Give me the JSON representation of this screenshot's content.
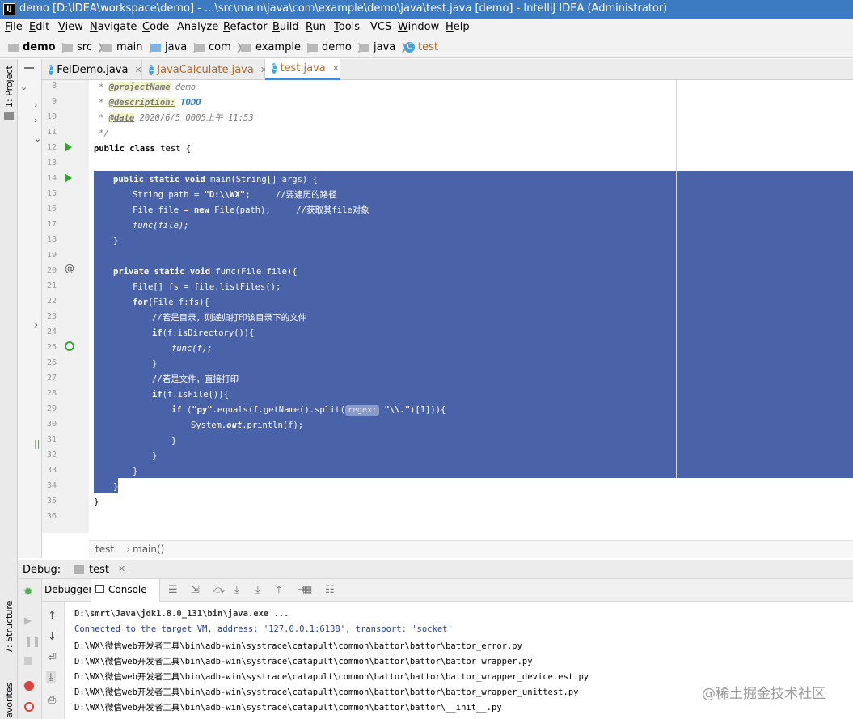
{
  "window": {
    "title": "demo [D:\\IDEA\\workspace\\demo] - ...\\src\\main\\java\\com\\example\\demo\\java\\test.java [demo] - IntelliJ IDEA (Administrator)",
    "app_icon": "IJ"
  },
  "menu": [
    {
      "label": "File",
      "u": "F",
      "rest": "ile"
    },
    {
      "label": "Edit",
      "u": "E",
      "rest": "dit"
    },
    {
      "label": "View",
      "u": "V",
      "rest": "iew"
    },
    {
      "label": "Navigate",
      "u": "N",
      "rest": "avigate"
    },
    {
      "label": "Code",
      "u": "C",
      "rest": "ode"
    },
    {
      "label": "Analyze",
      "u": "",
      "rest": "Analyze"
    },
    {
      "label": "Refactor",
      "u": "R",
      "rest": "efactor"
    },
    {
      "label": "Build",
      "u": "B",
      "rest": "uild"
    },
    {
      "label": "Run",
      "u": "R",
      "rest": "un"
    },
    {
      "label": "Tools",
      "u": "T",
      "rest": "ools"
    },
    {
      "label": "VCS",
      "u": "",
      "rest": "VCS"
    },
    {
      "label": "Window",
      "u": "W",
      "rest": "indow"
    },
    {
      "label": "Help",
      "u": "H",
      "rest": "elp"
    }
  ],
  "breadcrumb": [
    "demo",
    "src",
    "main",
    "java",
    "com",
    "example",
    "demo",
    "java",
    "test"
  ],
  "sidebar": {
    "project_label": "1: Project",
    "structure_label": "7: Structure",
    "favorites_label": "avorites"
  },
  "tabs": [
    {
      "label": "FelDemo.java",
      "active": false
    },
    {
      "label": "JavaCalculate.java",
      "active": false
    },
    {
      "label": "test.java",
      "active": true
    }
  ],
  "line_numbers": [
    "8",
    "9",
    "10",
    "11",
    "12",
    "13",
    "14",
    "15",
    "16",
    "17",
    "18",
    "19",
    "20",
    "21",
    "22",
    "23",
    "24",
    "25",
    "26",
    "27",
    "28",
    "29",
    "30",
    "31",
    "32",
    "33",
    "34",
    "35",
    "36"
  ],
  "code": {
    "l8_tag": "@projectName",
    "l8_val": " demo",
    "l9_tag": "@description:",
    "l9_val": "TODO",
    "l10_tag": "@date",
    "l10_val": " 2020/6/5 0005上午 11:53",
    "l11": " */",
    "l12_kw": "public class",
    "l12_rest": " test {",
    "l14_kw": "public static void",
    "l14_rest": " main(String[] args) {",
    "l15_a": "String path = ",
    "l15_str": "\"D:\\\\WX\";",
    "l15_c": "     //要遍历的路径",
    "l16_a": "File file = ",
    "l16_kw": "new",
    "l16_b": " File(path);",
    "l16_c": "     //获取其file对象",
    "l17": "func(file);",
    "l18": "}",
    "l20_kw": "private static void",
    "l20_rest": " func(File file){",
    "l21": "File[] fs = file.listFiles();",
    "l22_kw": "for",
    "l22_rest": "(File f:fs){",
    "l23": "//若是目录，则递归打印该目录下的文件",
    "l24_kw": "if",
    "l24_rest": "(f.isDirectory()){",
    "l25": "func(f);",
    "l26": "}",
    "l27": "//若是文件，直接打印",
    "l28_kw": "if",
    "l28_rest": "(f.isFile()){",
    "l29_kw": "if",
    "l29_a": " (",
    "l29_str": "\"py\"",
    "l29_b": ".equals(f.getName().split(",
    "l29_hint": "regex:",
    "l29_str2": " \"\\\\.\"",
    "l29_c": ")[1])){",
    "l30_a": "System.",
    "l30_out": "out",
    "l30_b": ".println(f);",
    "l31": "}",
    "l32": "}",
    "l33": "}",
    "l34": "}",
    "l35": "}"
  },
  "editor_crumb": [
    "test",
    "main()"
  ],
  "debug": {
    "title": "Debug:",
    "config": "test",
    "tab_debugger": "Debugger",
    "tab_console": "Console",
    "console_lines": [
      "D:\\smrt\\Java\\jdk1.8.0_131\\bin\\java.exe ...",
      "Connected to the target VM, address: '127.0.0.1:6138', transport: 'socket'",
      "D:\\WX\\微信web开发者工具\\bin\\adb-win\\systrace\\catapult\\common\\battor\\battor\\battor_error.py",
      "D:\\WX\\微信web开发者工具\\bin\\adb-win\\systrace\\catapult\\common\\battor\\battor\\battor_wrapper.py",
      "D:\\WX\\微信web开发者工具\\bin\\adb-win\\systrace\\catapult\\common\\battor\\battor\\battor_wrapper_devicetest.py",
      "D:\\WX\\微信web开发者工具\\bin\\adb-win\\systrace\\catapult\\common\\battor\\battor\\battor_wrapper_unittest.py",
      "D:\\WX\\微信web开发者工具\\bin\\adb-win\\systrace\\catapult\\common\\battor\\battor\\__init__.py"
    ]
  },
  "watermark": "@稀土掘金技术社区",
  "colors": {
    "title_bar": "#3c7ac2",
    "selection": "#4a63a8",
    "run_gutter": "#3aa03a",
    "debug_green": "#4caf50"
  }
}
